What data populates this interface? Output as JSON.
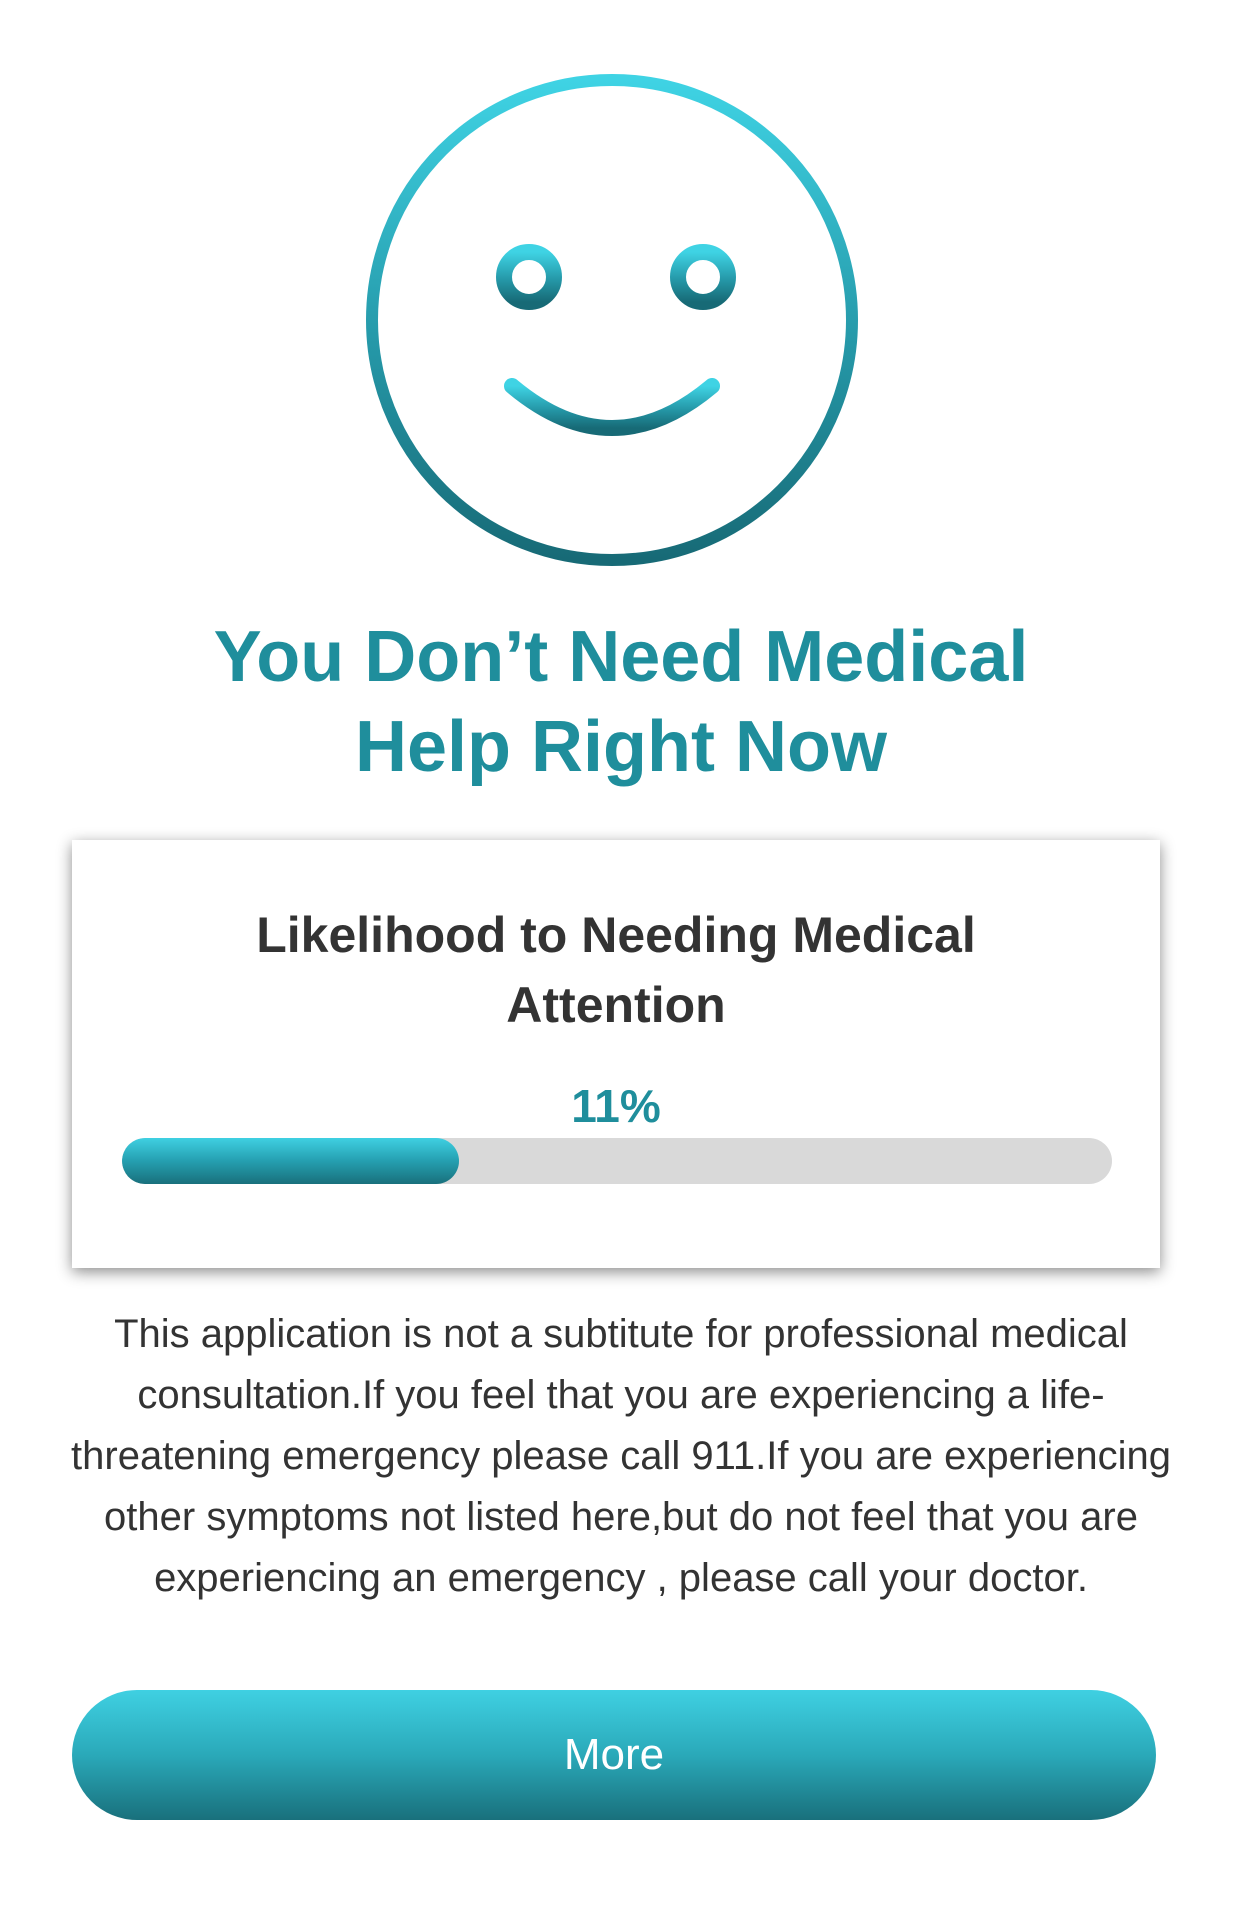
{
  "result": {
    "headline_line1": "You Don’t Need Medical",
    "headline_line2": "Help Right Now",
    "icon": "smiley-face-icon"
  },
  "likelihood_card": {
    "title": "Likelihood to Needing  Medical Attention",
    "percent_label": "11%",
    "bar_fill_fraction": 0.34
  },
  "disclaimer": "This application is not a subtitute for professional medical consultation.If you feel that you are experiencing a life-threatening emergency please call 911.If you are experiencing other symptoms not listed here,but do not feel that you are experiencing an emergency , please call your doctor.",
  "more_button": {
    "label": "More"
  },
  "colors": {
    "accent": "#1f8e9c",
    "gradient_top": "#3fd0e2",
    "gradient_bottom": "#19707c",
    "track": "#d9d9d9",
    "text": "#333333"
  }
}
